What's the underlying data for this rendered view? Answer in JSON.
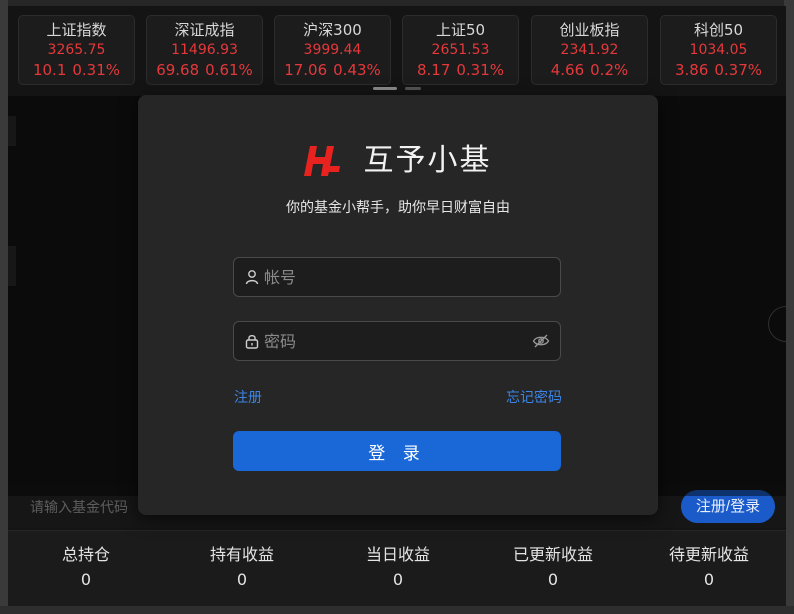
{
  "indices": [
    {
      "name": "上证指数",
      "price": "3265.75",
      "change": "10.1",
      "pct": "0.31%"
    },
    {
      "name": "深证成指",
      "price": "11496.93",
      "change": "69.68",
      "pct": "0.61%"
    },
    {
      "name": "沪深300",
      "price": "3999.44",
      "change": "17.06",
      "pct": "0.43%"
    },
    {
      "name": "上证50",
      "price": "2651.53",
      "change": "8.17",
      "pct": "0.31%"
    },
    {
      "name": "创业板指",
      "price": "2341.92",
      "change": "4.66",
      "pct": "0.2%"
    },
    {
      "name": "科创50",
      "price": "1034.05",
      "change": "3.86",
      "pct": "0.37%"
    }
  ],
  "login": {
    "app_name": "互予小基",
    "tagline": "你的基金小帮手，助你早日财富自由",
    "account_placeholder": "帐号",
    "password_placeholder": "密码",
    "register_link": "注册",
    "forgot_link": "忘记密码",
    "login_button": "登 录"
  },
  "search": {
    "placeholder": "请输入基金代码",
    "register_login_button": "注册/登录"
  },
  "summary": [
    {
      "label": "总持仓",
      "value": "0"
    },
    {
      "label": "持有收益",
      "value": "0"
    },
    {
      "label": "当日收益",
      "value": "0"
    },
    {
      "label": "已更新收益",
      "value": "0"
    },
    {
      "label": "待更新收益",
      "value": "0"
    }
  ],
  "colors": {
    "up": "#e5383b",
    "accent": "#1a67d8",
    "link": "#3b86e8",
    "logo": "#e8231f"
  }
}
